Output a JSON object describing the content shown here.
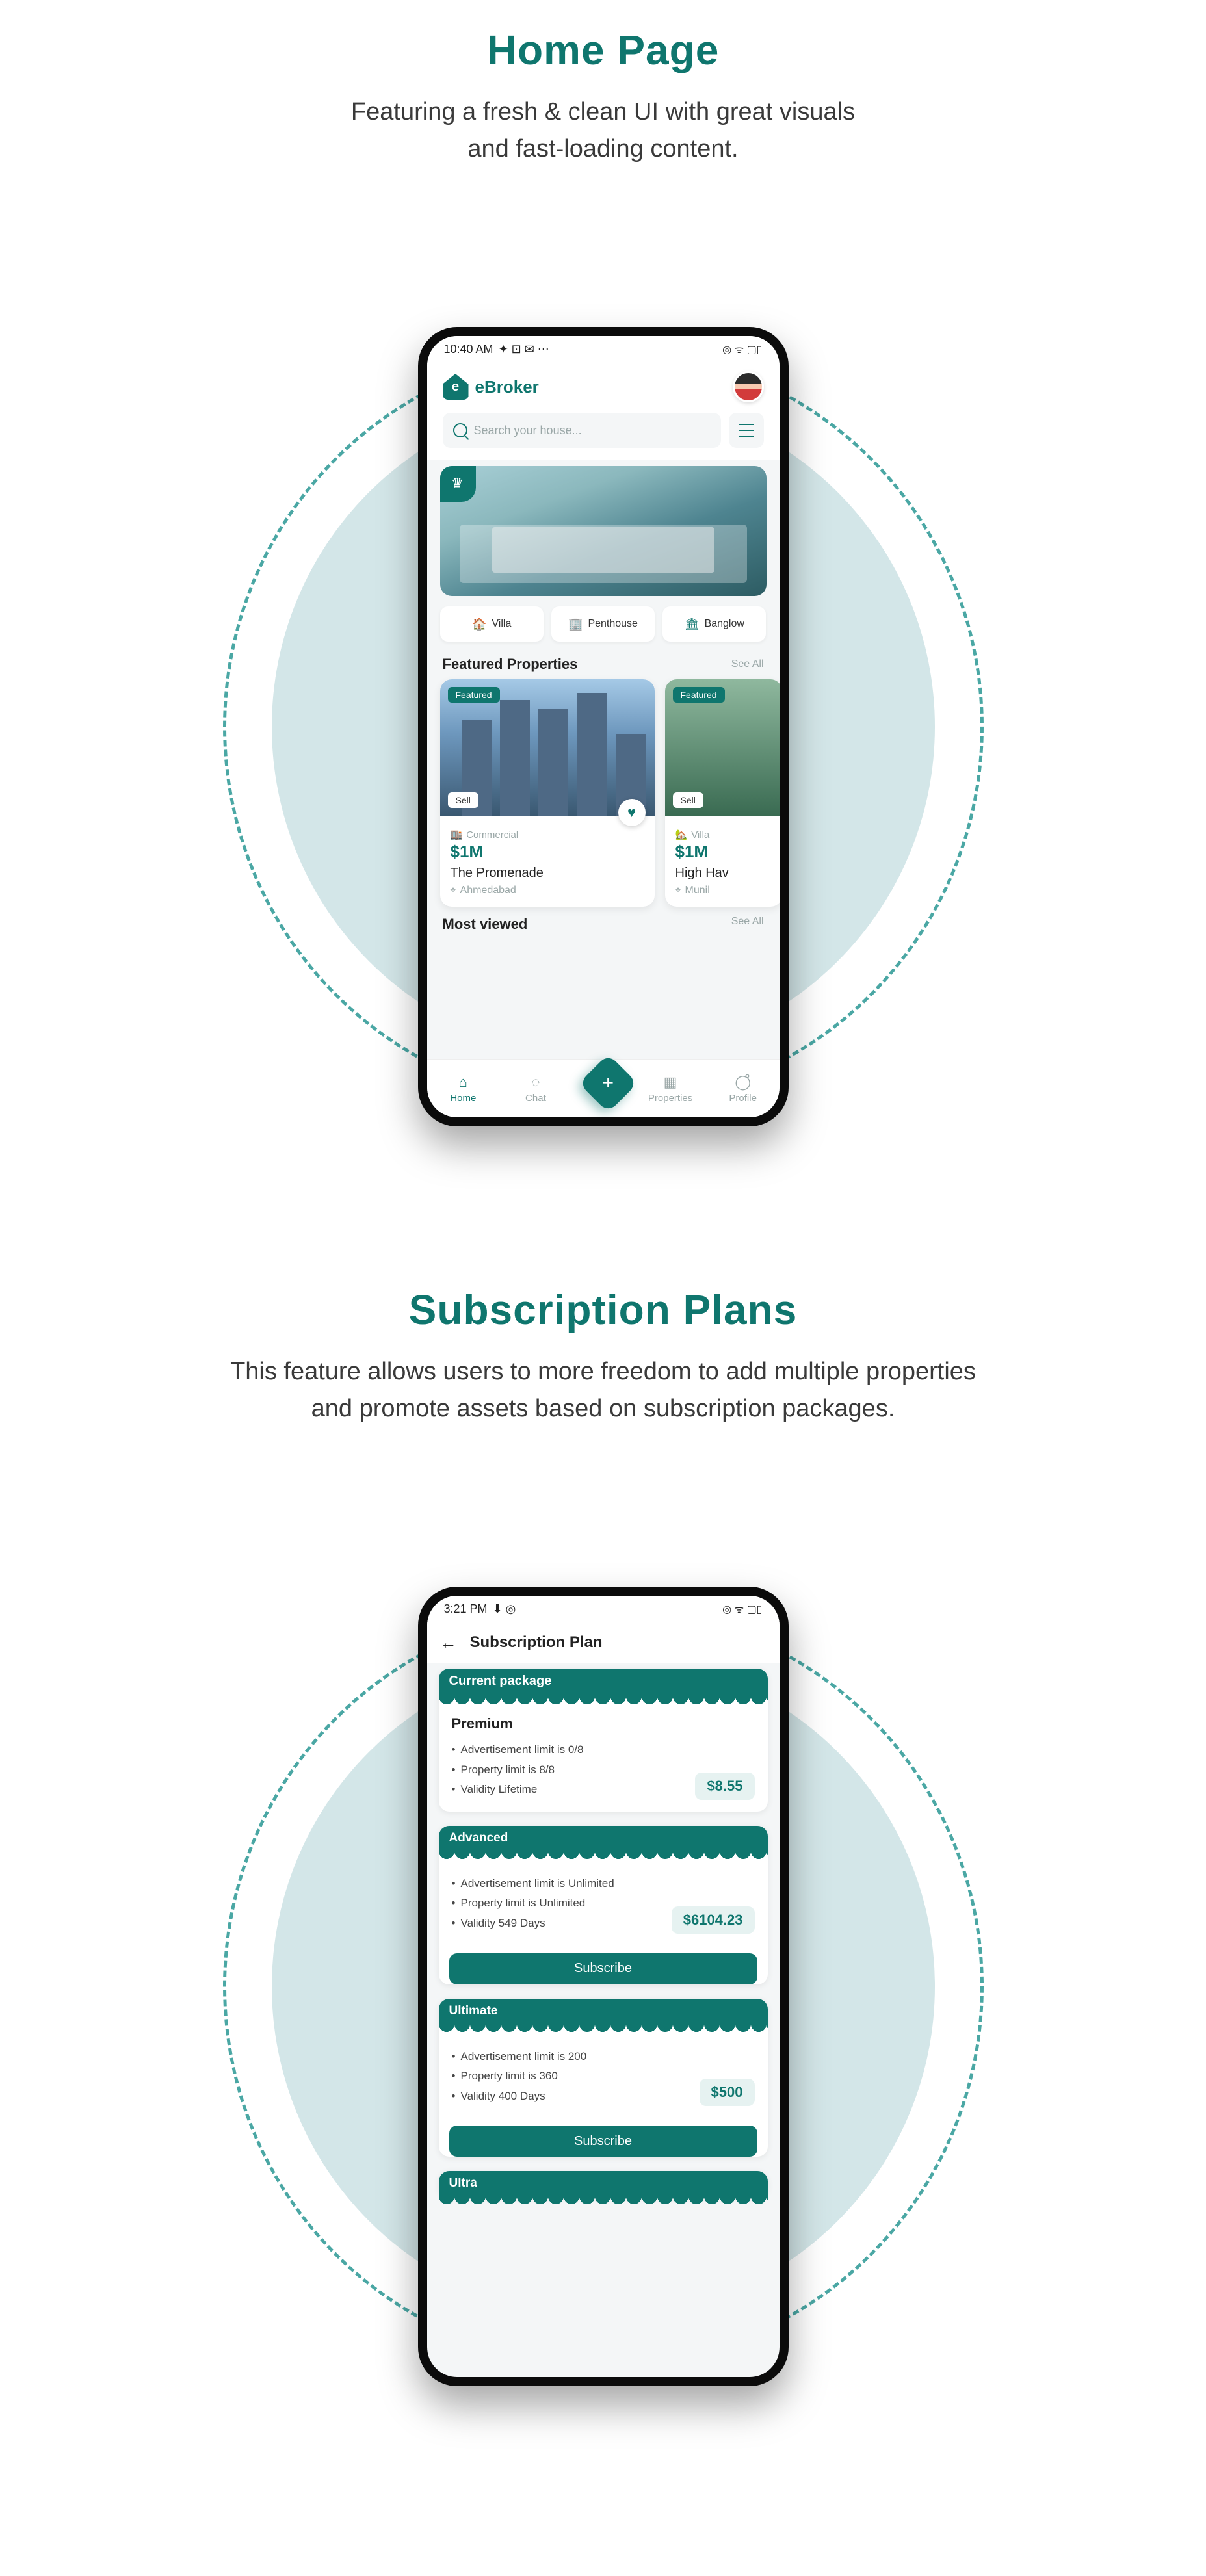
{
  "colors": {
    "teal": "#0f766e",
    "mint": "#d3e6e8"
  },
  "section1": {
    "title": "Home Page",
    "desc1": "Featuring a fresh & clean UI with great visuals",
    "desc2": "and fast-loading content."
  },
  "section2": {
    "title": "Subscription Plans",
    "desc1": "This feature allows users to more freedom to add multiple properties",
    "desc2": "and promote assets based on subscription packages."
  },
  "home": {
    "status": {
      "time": "10:40 AM",
      "icons_left": "✦ ⊡ ✉ ⋯",
      "icons_right": "◎ ᯤ ▢▯"
    },
    "brand": "eBroker",
    "search_placeholder": "Search your house...",
    "categories": [
      {
        "icon": "🏠",
        "label": "Villa"
      },
      {
        "icon": "🏢",
        "label": "Penthouse"
      },
      {
        "icon": "🏛",
        "label": "Banglow"
      }
    ],
    "featured_title": "Featured Properties",
    "see_all": "See All",
    "most_viewed": "Most viewed",
    "cards": [
      {
        "featured": "Featured",
        "sell": "Sell",
        "type_icon": "🏬",
        "type": "Commercial",
        "price": "$1M",
        "name": "The Promenade",
        "loc_icon": "⌖",
        "loc": "Ahmedabad"
      },
      {
        "featured": "Featured",
        "sell": "Sell",
        "type_icon": "🏡",
        "type": "Villa",
        "price": "$1M",
        "name": "High Hav",
        "loc_icon": "⌖",
        "loc": "Munil"
      }
    ],
    "nav": [
      {
        "icon": "⌂",
        "label": "Home"
      },
      {
        "icon": "◌",
        "label": "Chat"
      },
      {
        "icon": "▦",
        "label": "Properties"
      },
      {
        "icon": "◯̊",
        "label": "Profile"
      }
    ],
    "fab": "+"
  },
  "sub": {
    "status": {
      "time": "3:21 PM",
      "icons_left": "⬇ ◎",
      "icons_right": "◎ ᯤ ▢▯"
    },
    "page_title": "Subscription Plan",
    "current_label": "Current package",
    "plans": [
      {
        "name": "Premium",
        "bullets": [
          "Advertisement limit is 0/8",
          "Property limit  is 8/8",
          "Validity Lifetime"
        ],
        "price": "$8.55",
        "show_subscribe": false
      },
      {
        "title": "Advanced",
        "bullets": [
          "Advertisement limit is Unlimited",
          "Property limit  is Unlimited",
          "Validity 549 Days"
        ],
        "price": "$6104.23",
        "show_subscribe": true
      },
      {
        "title": "Ultimate",
        "bullets": [
          "Advertisement limit is 200",
          "Property limit  is 360",
          "Validity 400 Days"
        ],
        "price": "$500",
        "show_subscribe": true
      },
      {
        "title": "Ultra",
        "bullets": [],
        "price": "",
        "show_subscribe": false
      }
    ],
    "subscribe_label": "Subscribe"
  }
}
